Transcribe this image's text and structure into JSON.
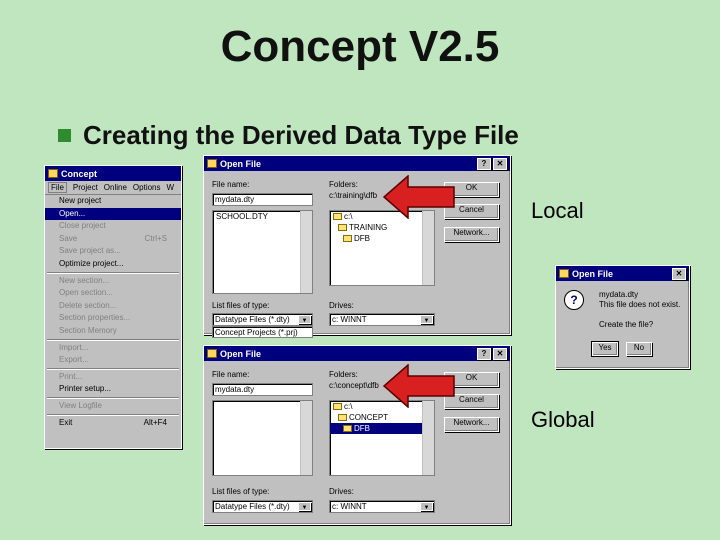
{
  "slide": {
    "title": "Concept V2.5",
    "bullet": "Creating the Derived Data Type File",
    "label_local": "Local",
    "label_global": "Global"
  },
  "concept_menu": {
    "title": "Concept",
    "menubar": [
      "File",
      "Project",
      "Online",
      "Options",
      "W"
    ],
    "items": [
      {
        "label": "New project",
        "shortcut": "",
        "state": "normal"
      },
      {
        "label": "Open...",
        "shortcut": "",
        "state": "selected"
      },
      {
        "label": "Close project",
        "shortcut": "",
        "state": "disabled"
      },
      {
        "label": "Save",
        "shortcut": "Ctrl+S",
        "state": "disabled"
      },
      {
        "label": "Save project as...",
        "shortcut": "",
        "state": "disabled"
      },
      {
        "label": "Optimize project...",
        "shortcut": "",
        "state": "normal"
      },
      {
        "sep": true
      },
      {
        "label": "New section...",
        "shortcut": "",
        "state": "disabled"
      },
      {
        "label": "Open section...",
        "shortcut": "",
        "state": "disabled"
      },
      {
        "label": "Delete section...",
        "shortcut": "",
        "state": "disabled"
      },
      {
        "label": "Section properties...",
        "shortcut": "",
        "state": "disabled"
      },
      {
        "label": "Section Memory",
        "shortcut": "",
        "state": "disabled"
      },
      {
        "sep": true
      },
      {
        "label": "Import...",
        "shortcut": "",
        "state": "disabled"
      },
      {
        "label": "Export...",
        "shortcut": "",
        "state": "disabled"
      },
      {
        "sep": true
      },
      {
        "label": "Print...",
        "shortcut": "",
        "state": "disabled"
      },
      {
        "label": "Printer setup...",
        "shortcut": "",
        "state": "normal"
      },
      {
        "sep": true
      },
      {
        "label": "View Logfile",
        "shortcut": "",
        "state": "disabled"
      },
      {
        "sep": true
      },
      {
        "label": "Exit",
        "shortcut": "Alt+F4",
        "state": "normal"
      }
    ]
  },
  "open_file_local": {
    "title": "Open File",
    "file_name_label": "File name:",
    "file_name_value": "mydata.dty",
    "file_list": [
      "SCHOOL.DTY"
    ],
    "folders_label": "Folders:",
    "folder_path": "c:\\training\\dfb",
    "folder_tree": [
      {
        "label": "c:\\",
        "selected": false
      },
      {
        "label": "TRAINING",
        "selected": false
      },
      {
        "label": "DFB",
        "selected": false
      }
    ],
    "ok": "OK",
    "cancel": "Cancel",
    "network": "Network...",
    "types_label": "List files of type:",
    "types_value": "Datatype Files (*.dty)",
    "types_open_option": "Concept Projects (*.prj)",
    "drives_label": "Drives:",
    "drives_value": "c: WINNT"
  },
  "open_file_global": {
    "title": "Open File",
    "file_name_label": "File name:",
    "file_name_value": "mydata.dty",
    "folders_label": "Folders:",
    "folder_path": "c:\\concept\\dfb",
    "folder_tree": [
      {
        "label": "c:\\",
        "selected": false
      },
      {
        "label": "CONCEPT",
        "selected": false
      },
      {
        "label": "DFB",
        "selected": true
      }
    ],
    "ok": "OK",
    "cancel": "Cancel",
    "network": "Network...",
    "types_label": "List files of type:",
    "types_value": "Datatype Files (*.dty)",
    "drives_label": "Drives:",
    "drives_value": "c: WINNT"
  },
  "confirm_dialog": {
    "title": "Open File",
    "line1": "mydata.dty",
    "line2": "This file does not exist.",
    "line3": "Create the file?",
    "yes": "Yes",
    "no": "No"
  },
  "colors": {
    "background": "#bfe6bf",
    "bullet": "#2e8b2e",
    "titlebar": "#00007f",
    "arrow": "#d92020"
  }
}
